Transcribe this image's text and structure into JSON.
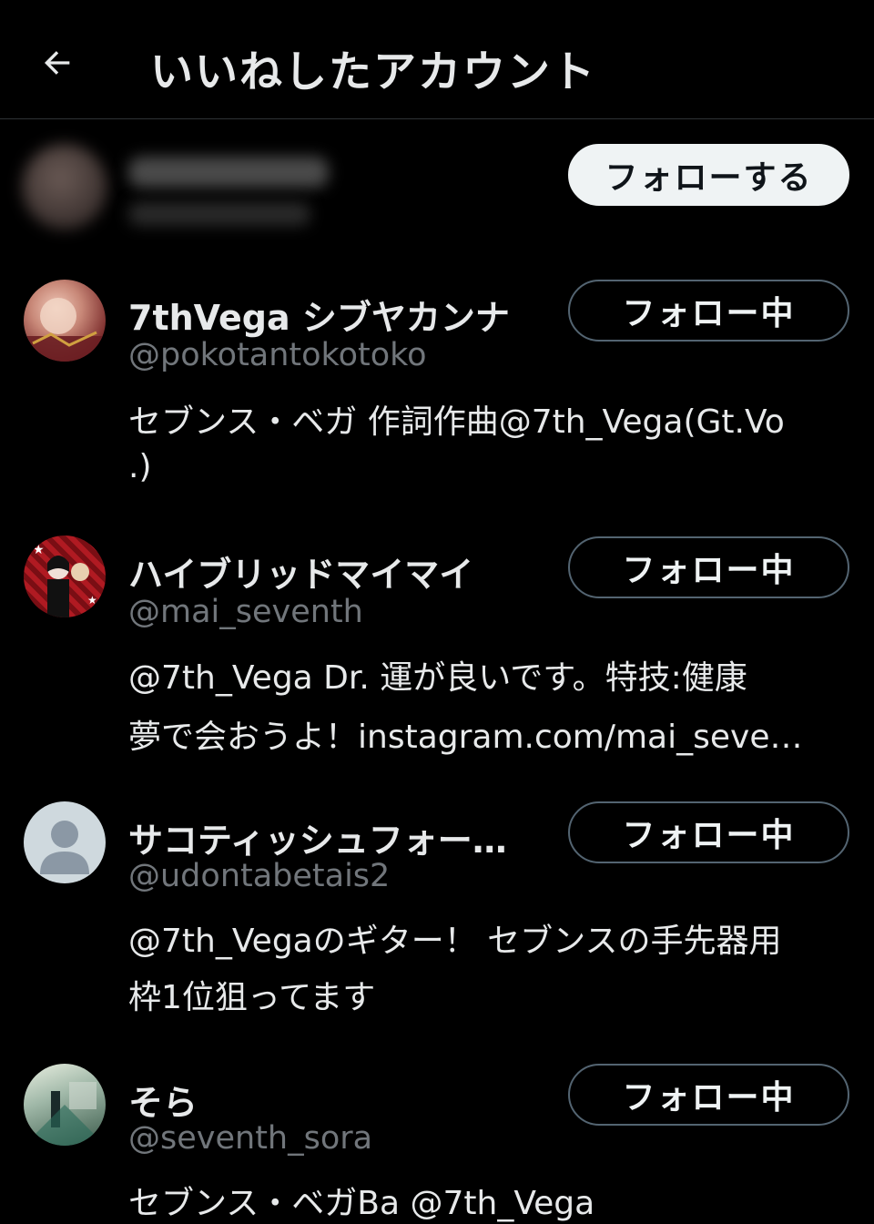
{
  "header": {
    "title": "いいねしたアカウント",
    "back_icon": "arrow-left-icon"
  },
  "hidden_user": {
    "button_label": "フォローする"
  },
  "users": [
    {
      "name": "7thVega シブヤカンナ",
      "handle": "@pokotantokotoko",
      "bio_lines": [
        "セブンス・ベガ 作詞作曲@7th_Vega(Gt.Vo",
        ".)"
      ],
      "button_label": "フォロー中",
      "avatar_colors": [
        "#e8b8a8",
        "#7a2a2a"
      ]
    },
    {
      "name": "ハイブリッドマイマイ",
      "handle": "@mai_seventh",
      "bio_lines": [
        "@7th_Vega Dr. 運が良いです。特技:健康",
        "夢で会おうよ！instagram.com/mai_seve…"
      ],
      "button_label": "フォロー中",
      "avatar_colors": [
        "#c0222a",
        "#1a1a1a"
      ]
    },
    {
      "name": "サコティッシュフォー…",
      "handle": "@udontabetais2",
      "bio_lines": [
        "@7th_Vegaのギター！ セブンスの手先器用",
        "枠1位狙ってます"
      ],
      "button_label": "フォロー中",
      "avatar_colors": [
        "#cfd9de",
        "#8b98a5"
      ]
    },
    {
      "name": "そら",
      "handle": "@seventh_sora",
      "bio_lines": [
        "セブンス・ベガBa  @7th_Vega"
      ],
      "button_label": "フォロー中",
      "avatar_colors": [
        "#d8e0d0",
        "#4a6a5a"
      ]
    }
  ],
  "colors": {
    "background": "#000000",
    "primary_text": "#e7e9ea",
    "secondary_text": "#71767b",
    "divider": "#2f3336",
    "button_border": "#536471"
  }
}
